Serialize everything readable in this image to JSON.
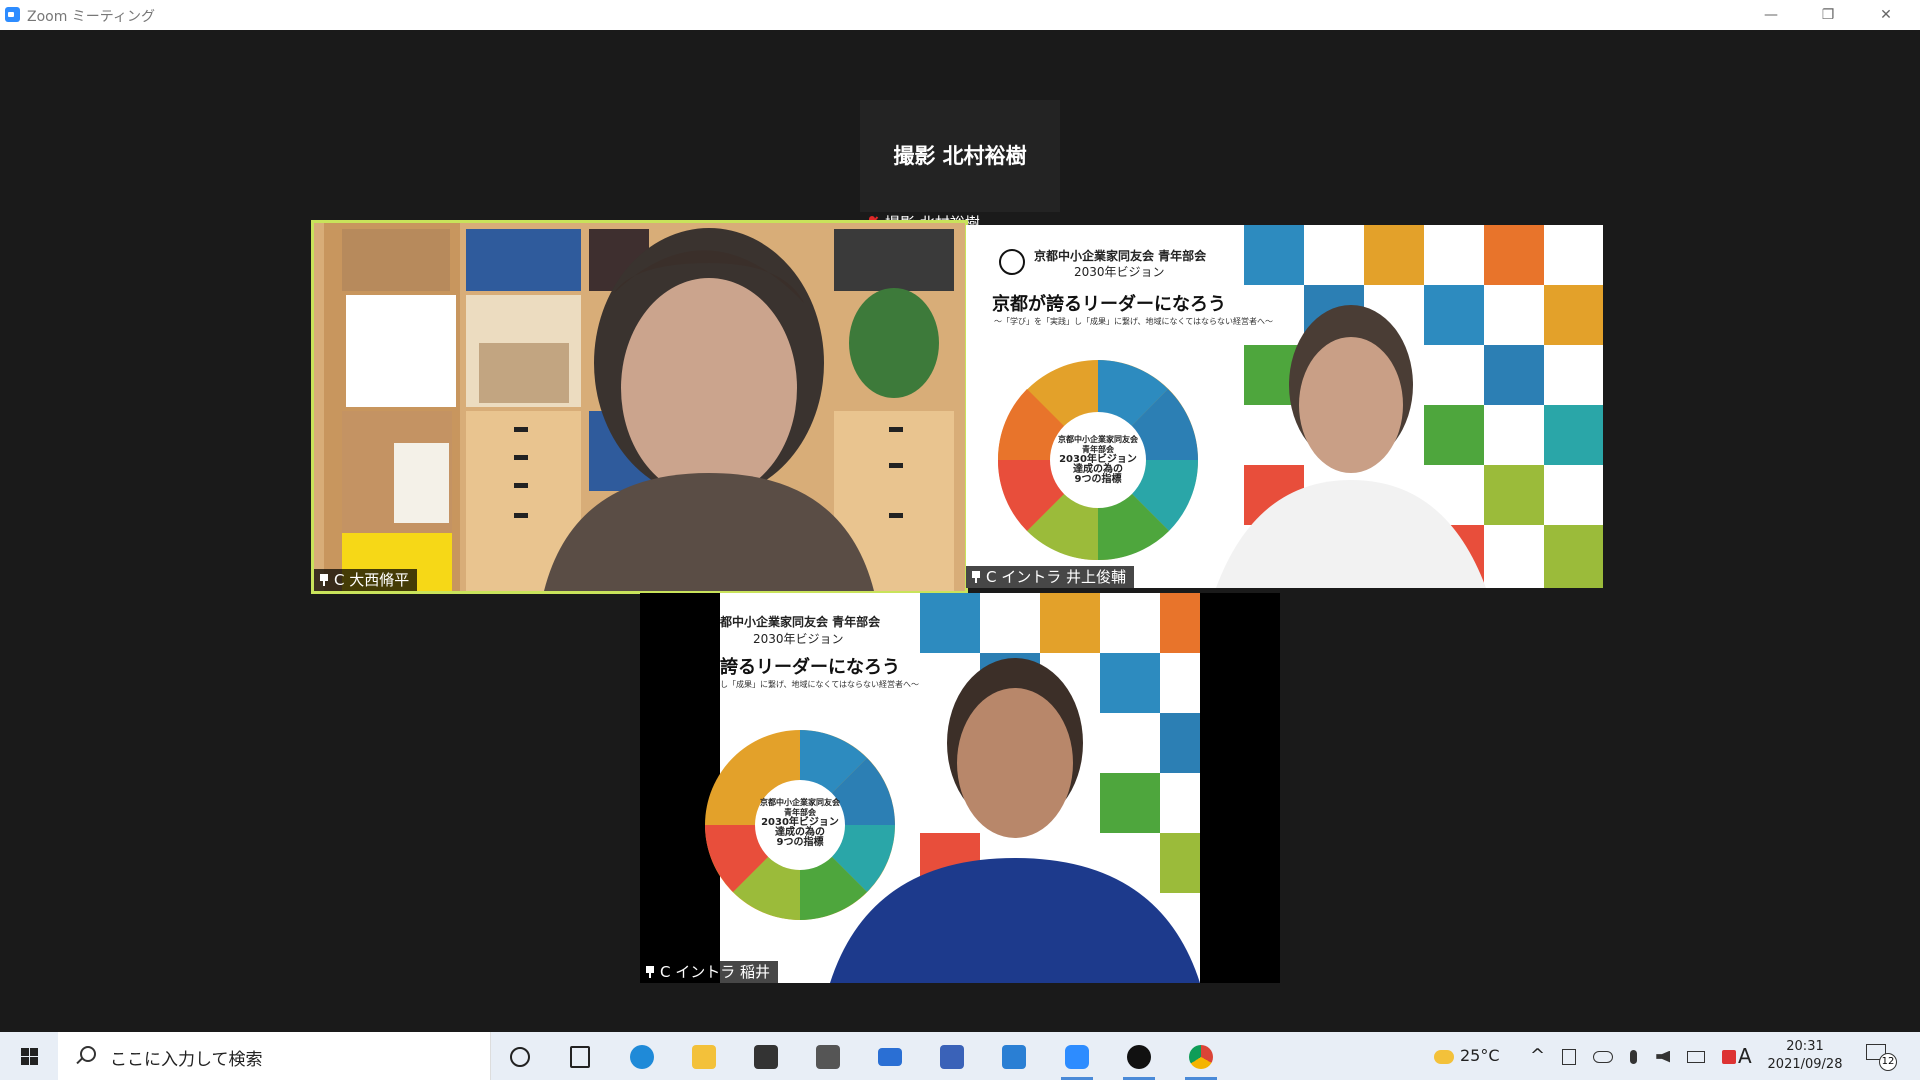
{
  "window": {
    "title": "Zoom ミーティング",
    "controls": {
      "minimize": "—",
      "maximize": "❐",
      "close": "✕"
    }
  },
  "participants": {
    "top": {
      "display_name": "撮影 北村裕樹",
      "label": "撮影 北村裕樹",
      "muted": true
    },
    "p1": {
      "label": "C 大西脩平",
      "pinned": true,
      "active_speaker": true
    },
    "p2": {
      "label": "C イントラ 井上俊輔",
      "pinned": true
    },
    "p3": {
      "label": "C イントラ 稲井",
      "pinned": true
    }
  },
  "vision_board": {
    "org": "京都中小企業家同友会 青年部会",
    "year": "2030年ビジョン",
    "headline": "京都が誇るリーダーになろう",
    "subline": "～「学び」を「実践」し「成果」に繋げ、地域になくてはならない経営者へ～",
    "center_lines": [
      "京都中小企業家同友会",
      "青年部会",
      "2030年ビジョン",
      "達成の為の",
      "9つの指標"
    ],
    "tile3_org": "都中小企業家同友会 青年部会",
    "tile3_year": "2030年ビジョン",
    "tile3_headline": "誇るリーダーになろう",
    "tile3_subline": "し「成果」に繋げ、地域になくてはならない経営者へ～",
    "tile3_center_lines": [
      "京都中小企業家同友会",
      "青年部会",
      "2030年ビジョン",
      "達成の為の",
      "9つの指標"
    ],
    "colors": [
      "#2d8bbf",
      "#1f5c96",
      "#e3a12a",
      "#e8742b",
      "#4ea63d",
      "#2aa6a8",
      "#9bbb3a",
      "#e84e3b",
      "#2c7fb4"
    ]
  },
  "taskbar": {
    "search_placeholder": "ここに入力して検索",
    "weather": "25°C",
    "ime": "A",
    "time": "20:31",
    "date": "2021/09/28",
    "notification_count": "12"
  }
}
